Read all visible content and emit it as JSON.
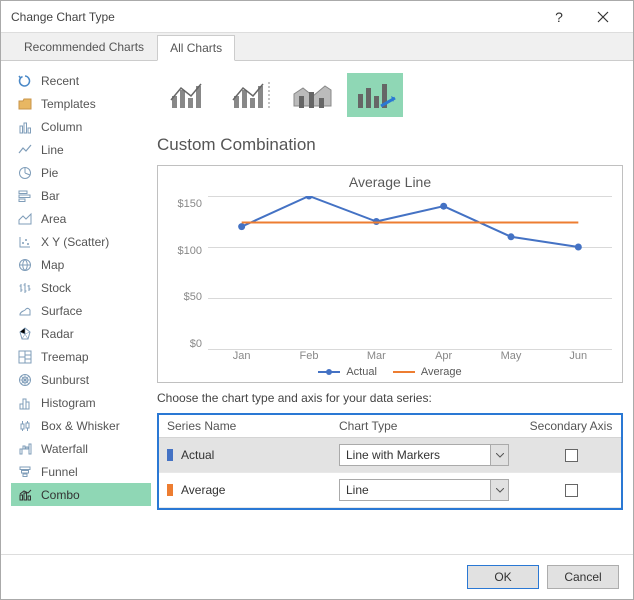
{
  "title": "Change Chart Type",
  "tabs": {
    "recommended": "Recommended Charts",
    "all": "All Charts"
  },
  "sidebar": {
    "items": [
      {
        "label": "Recent"
      },
      {
        "label": "Templates"
      },
      {
        "label": "Column"
      },
      {
        "label": "Line"
      },
      {
        "label": "Pie"
      },
      {
        "label": "Bar"
      },
      {
        "label": "Area"
      },
      {
        "label": "X Y (Scatter)"
      },
      {
        "label": "Map"
      },
      {
        "label": "Stock"
      },
      {
        "label": "Surface"
      },
      {
        "label": "Radar"
      },
      {
        "label": "Treemap"
      },
      {
        "label": "Sunburst"
      },
      {
        "label": "Histogram"
      },
      {
        "label": "Box & Whisker"
      },
      {
        "label": "Waterfall"
      },
      {
        "label": "Funnel"
      },
      {
        "label": "Combo"
      }
    ]
  },
  "heading": "Custom Combination",
  "chart_data": {
    "type": "line",
    "title": "Average Line",
    "ylabel": "",
    "xlabel": "",
    "ylim": [
      0,
      150
    ],
    "yticks": [
      "$150",
      "$100",
      "$50",
      "$0"
    ],
    "categories": [
      "Jan",
      "Feb",
      "Mar",
      "Apr",
      "May",
      "Jun"
    ],
    "series": [
      {
        "name": "Actual",
        "type": "line_with_markers",
        "color": "#4472c4",
        "values": [
          120,
          150,
          125,
          140,
          110,
          100
        ]
      },
      {
        "name": "Average",
        "type": "line",
        "color": "#ed7d31",
        "values": [
          124,
          124,
          124,
          124,
          124,
          124
        ]
      }
    ],
    "legend": [
      "Actual",
      "Average"
    ]
  },
  "series_section_label": "Choose the chart type and axis for your data series:",
  "series_table": {
    "headers": {
      "name": "Series Name",
      "type": "Chart Type",
      "axis": "Secondary Axis"
    },
    "rows": [
      {
        "name": "Actual",
        "chart_type": "Line with Markers",
        "secondary": false
      },
      {
        "name": "Average",
        "chart_type": "Line",
        "secondary": false
      }
    ]
  },
  "footer": {
    "ok": "OK",
    "cancel": "Cancel"
  }
}
